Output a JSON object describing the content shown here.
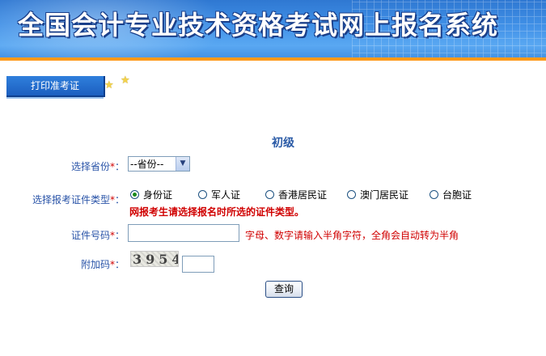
{
  "header": {
    "title": "全国会计专业技术资格考试网上报名系统"
  },
  "tabs": [
    {
      "label": "打印准考证",
      "active": true
    }
  ],
  "form": {
    "level": "初级",
    "province": {
      "label": "选择省份",
      "required_mark": "*",
      "selected": "--省份--"
    },
    "id_type": {
      "label": "选择报考证件类型",
      "required_mark": "*",
      "options": [
        "身份证",
        "军人证",
        "香港居民证",
        "澳门居民证",
        "台胞证"
      ],
      "selected_index": 0,
      "warning": "网报考生请选择报名时所选的证件类型。"
    },
    "id_number": {
      "label": "证件号码",
      "required_mark": "*",
      "value": "",
      "hint": "字母、数字请输入半角字符，全角会自动转为半角"
    },
    "captcha": {
      "label": "附加码",
      "required_mark": "*",
      "code": "3954",
      "value": ""
    },
    "submit_label": "查询"
  },
  "colors": {
    "banner_blue": "#3f8fe6",
    "accent_orange": "#ff9a1a",
    "label_blue": "#2a54a8",
    "warning_red": "#d00000"
  },
  "icons": {
    "star": "star-icon",
    "dropdown": "chevron-down-icon"
  }
}
